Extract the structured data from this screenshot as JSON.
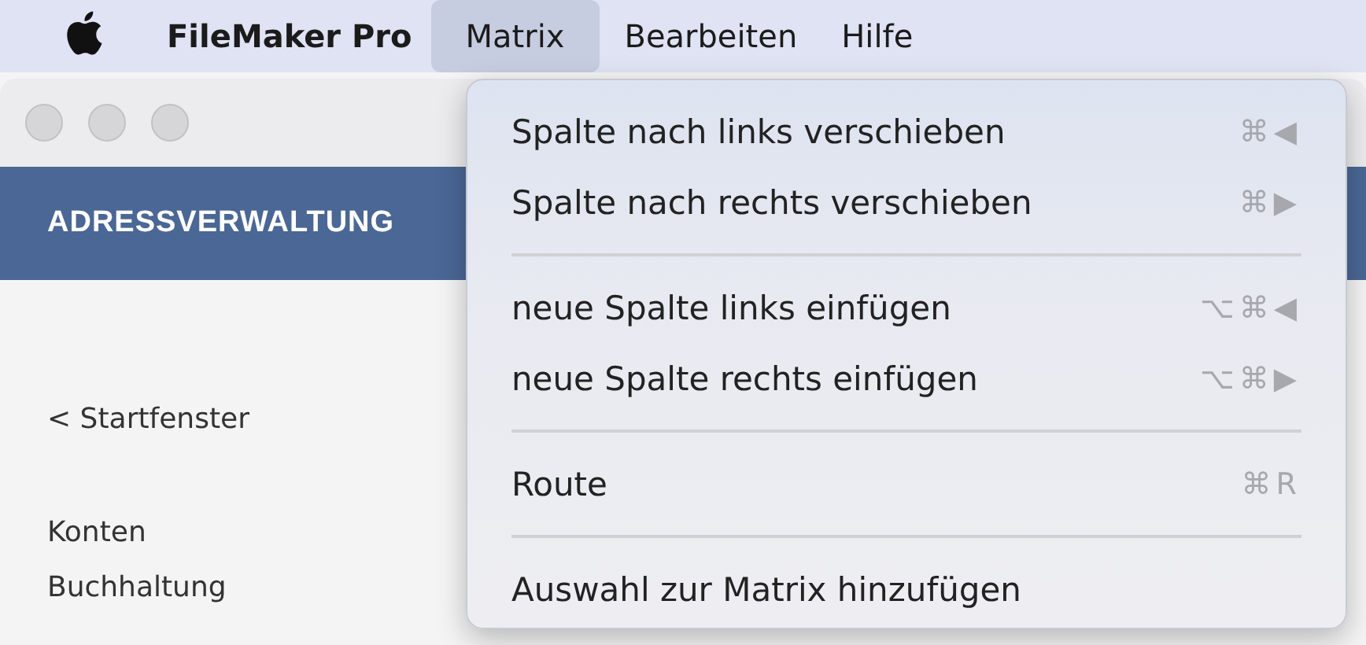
{
  "menu_bar": {
    "app_name": "FileMaker Pro",
    "menus": [
      {
        "label": "Matrix",
        "selected": true
      },
      {
        "label": "Bearbeiten",
        "selected": false
      },
      {
        "label": "Hilfe",
        "selected": false
      }
    ]
  },
  "window": {
    "header": "ADRESSVERWALTUNG",
    "sidebar": {
      "back_link": "< Startfenster",
      "items": [
        "Konten",
        "Buchhaltung"
      ]
    }
  },
  "dropdown": {
    "items": [
      {
        "kind": "item",
        "label": "Spalte nach links verschieben",
        "shortcut": "⌘◀"
      },
      {
        "kind": "item",
        "label": "Spalte nach rechts verschieben",
        "shortcut": "⌘▶"
      },
      {
        "kind": "separator"
      },
      {
        "kind": "item",
        "label": "neue Spalte links einfügen",
        "shortcut": "⌥⌘◀"
      },
      {
        "kind": "item",
        "label": "neue Spalte rechts einfügen",
        "shortcut": "⌥⌘▶"
      },
      {
        "kind": "separator"
      },
      {
        "kind": "item",
        "label": "Route",
        "shortcut": "⌘R"
      },
      {
        "kind": "separator"
      },
      {
        "kind": "item",
        "label": "Auswahl zur Matrix hinzufügen"
      }
    ]
  }
}
